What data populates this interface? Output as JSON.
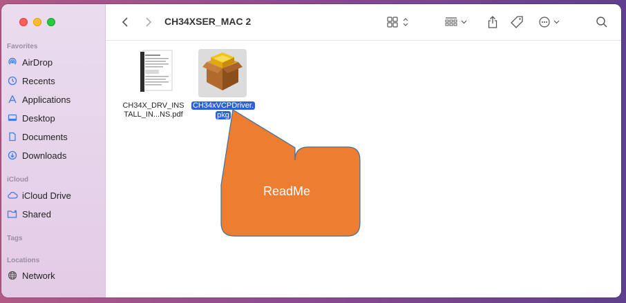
{
  "window": {
    "title": "CH34XSER_MAC 2"
  },
  "sidebar": {
    "favorites_label": "Favorites",
    "favorites": [
      {
        "label": "AirDrop",
        "icon": "airdrop-icon"
      },
      {
        "label": "Recents",
        "icon": "clock-icon"
      },
      {
        "label": "Applications",
        "icon": "applications-icon"
      },
      {
        "label": "Desktop",
        "icon": "desktop-icon"
      },
      {
        "label": "Documents",
        "icon": "document-icon"
      },
      {
        "label": "Downloads",
        "icon": "download-icon"
      }
    ],
    "icloud_label": "iCloud",
    "icloud": [
      {
        "label": "iCloud Drive",
        "icon": "cloud-icon"
      },
      {
        "label": "Shared",
        "icon": "shared-folder-icon"
      }
    ],
    "tags_label": "Tags",
    "locations_label": "Locations",
    "locations": [
      {
        "label": "Network",
        "icon": "globe-icon"
      }
    ]
  },
  "files": [
    {
      "line1": "CH34X_DRV_INS",
      "line2": "TALL_IN...NS.pdf",
      "selected": false,
      "icon": "pdf-document-icon"
    },
    {
      "line1": "CH34xVCPDriver.",
      "line2": "pkg",
      "selected": true,
      "icon": "package-icon"
    }
  ],
  "callout": {
    "text": "ReadMe",
    "color": "#ed7d31"
  },
  "colors": {
    "accent": "#2a62d9",
    "sidebar_icon": "#3a7ee6"
  }
}
